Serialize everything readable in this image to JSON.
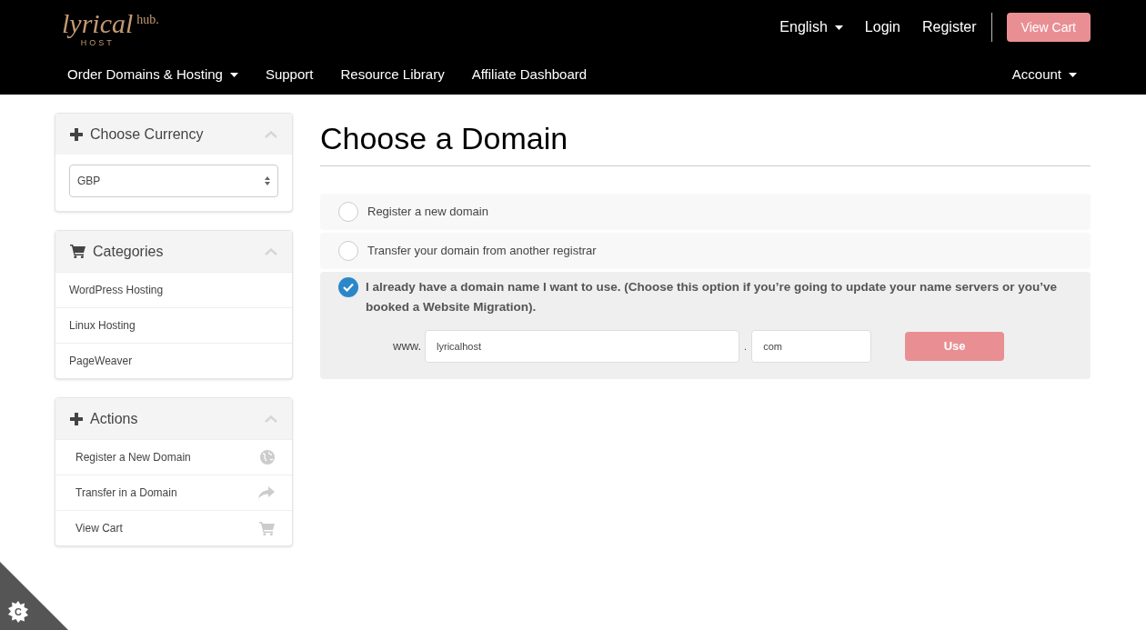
{
  "logo": {
    "script": "lyrical",
    "suffix": "hub.",
    "sub": "HOST"
  },
  "top_links": [
    {
      "label": "English",
      "dropdown": true
    },
    {
      "label": "Login",
      "dropdown": false
    },
    {
      "label": "Register",
      "dropdown": false
    }
  ],
  "cart_button": "View Cart",
  "nav": [
    {
      "label": "Order Domains & Hosting",
      "dropdown": true
    },
    {
      "label": "Support",
      "dropdown": false
    },
    {
      "label": "Resource Library",
      "dropdown": false
    },
    {
      "label": "Affiliate Dashboard",
      "dropdown": false
    }
  ],
  "account": {
    "label": "Account",
    "dropdown": true
  },
  "sidebar": [
    {
      "title": "Choose Currency",
      "kind": "select",
      "value": "GBP"
    },
    {
      "title": "Categories",
      "kind": "list",
      "items": [
        {
          "label": "WordPress Hosting"
        },
        {
          "label": "Linux Hosting"
        },
        {
          "label": "PageWeaver"
        }
      ]
    },
    {
      "title": "Actions",
      "kind": "actions",
      "items": [
        {
          "label": "Register a New Domain"
        },
        {
          "label": "Transfer in a Domain"
        },
        {
          "label": "View Cart"
        }
      ]
    }
  ],
  "heading": "Choose a Domain",
  "options": [
    {
      "label": "Register a new domain",
      "selected": false
    },
    {
      "label": "Transfer your domain from another registrar",
      "selected": false
    },
    {
      "label": "I already have a domain name I want to use. (Choose this option if you’re going to update your name servers or you’ve booked a Website Migration).",
      "selected": true
    }
  ],
  "domain_form": {
    "prefix": "www.",
    "name": "lyricalhost",
    "separator": ".",
    "tld": "com",
    "button": "Use"
  },
  "corner_badge": {
    "label": "C"
  }
}
